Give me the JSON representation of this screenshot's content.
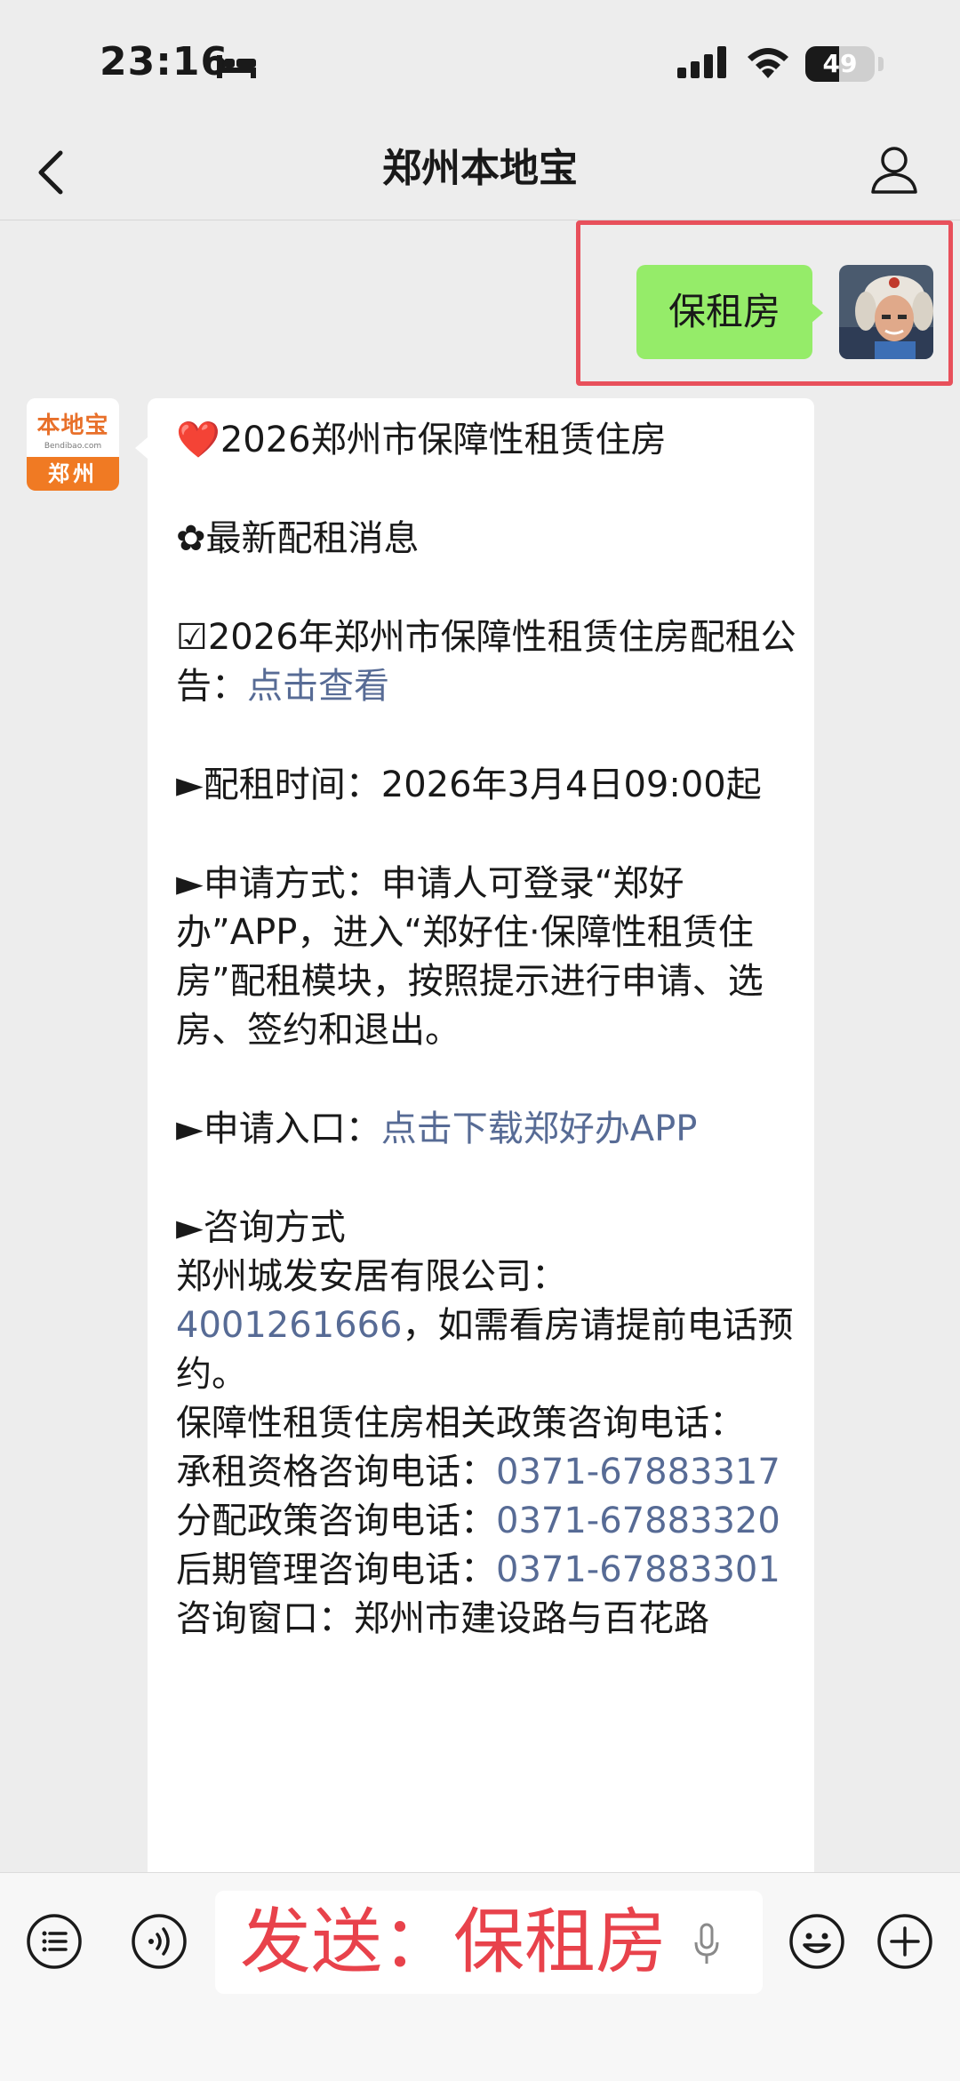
{
  "status_bar": {
    "time": "23:16",
    "battery_level": "49",
    "icons": [
      "bed-icon",
      "signal-icon",
      "wifi-icon",
      "battery-icon"
    ]
  },
  "nav": {
    "title": "郑州本地宝",
    "icons": [
      "back-icon",
      "person-icon"
    ]
  },
  "sent_message": {
    "text": "保租房",
    "bubble_color": "#95ec69",
    "highlight_color": "#e8505b"
  },
  "sender_logo": {
    "main": "本地宝",
    "sub": "Bendibao.com",
    "city": "郑州",
    "brand_color": "#f07a23"
  },
  "reply": {
    "title_icon": "❤️",
    "title": "2026郑州市保障性租赁住房",
    "section": "✿最新配租消息",
    "notice_prefix": "☑2026年郑州市保障性租赁住房配租公告：",
    "notice_link": "点击查看",
    "time_line": "►配租时间：2026年3月4日09:00起",
    "method_line": "►申请方式：申请人可登录“郑好办”APP，进入“郑好住·保障性租赁住房”配租模块，按照提示进行申请、选房、签约和退出。",
    "entry_prefix": "►申请入口：",
    "entry_link": "点击下载郑好办APP",
    "consult_title": "►咨询方式",
    "company_line": "郑州城发安居有限公司：",
    "company_phone": "4001261666",
    "company_note": "，如需看房请提前电话预约。",
    "policy_line": "保障性租赁住房相关政策咨询电话：",
    "qual_label": "承租资格咨询电话：",
    "qual_phone": "0371-67883317",
    "alloc_label": "分配政策咨询电话：",
    "alloc_phone": "0371-67883320",
    "mgmt_label": "后期管理咨询电话：",
    "mgmt_phone": "0371-67883301",
    "window_line": "咨询窗口：郑州市建设路与百花路",
    "link_color": "#576b95"
  },
  "input_bar": {
    "text": "发送：保租房",
    "text_color": "#e8424b",
    "icons": [
      "list-icon",
      "voice-icon",
      "mic-icon",
      "emoji-icon",
      "plus-icon"
    ]
  }
}
